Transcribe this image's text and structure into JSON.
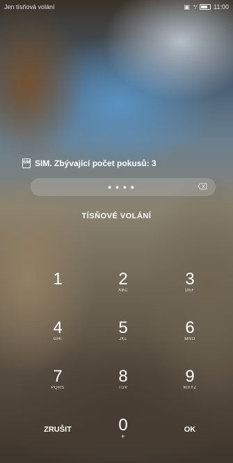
{
  "status_bar": {
    "carrier_text": "Jen tísňová volání",
    "time": "11:00"
  },
  "sim_prompt": "SIM. Zbývající počet pokusů: 3",
  "sim_icon_label": "SIM",
  "pin_dots": "••••",
  "emergency_label": "TÍSŇOVÉ VOLÁNÍ",
  "keypad": {
    "k1": {
      "digit": "1",
      "letters": ""
    },
    "k2": {
      "digit": "2",
      "letters": "ABC"
    },
    "k3": {
      "digit": "3",
      "letters": "DEF"
    },
    "k4": {
      "digit": "4",
      "letters": "GHI"
    },
    "k5": {
      "digit": "5",
      "letters": "JKL"
    },
    "k6": {
      "digit": "6",
      "letters": "MNO"
    },
    "k7": {
      "digit": "7",
      "letters": "PQRS"
    },
    "k8": {
      "digit": "8",
      "letters": "TUV"
    },
    "k9": {
      "digit": "9",
      "letters": "WXYZ"
    },
    "k0": {
      "digit": "0",
      "letters": "+"
    },
    "cancel_label": "ZRUŠIT",
    "ok_label": "OK"
  }
}
